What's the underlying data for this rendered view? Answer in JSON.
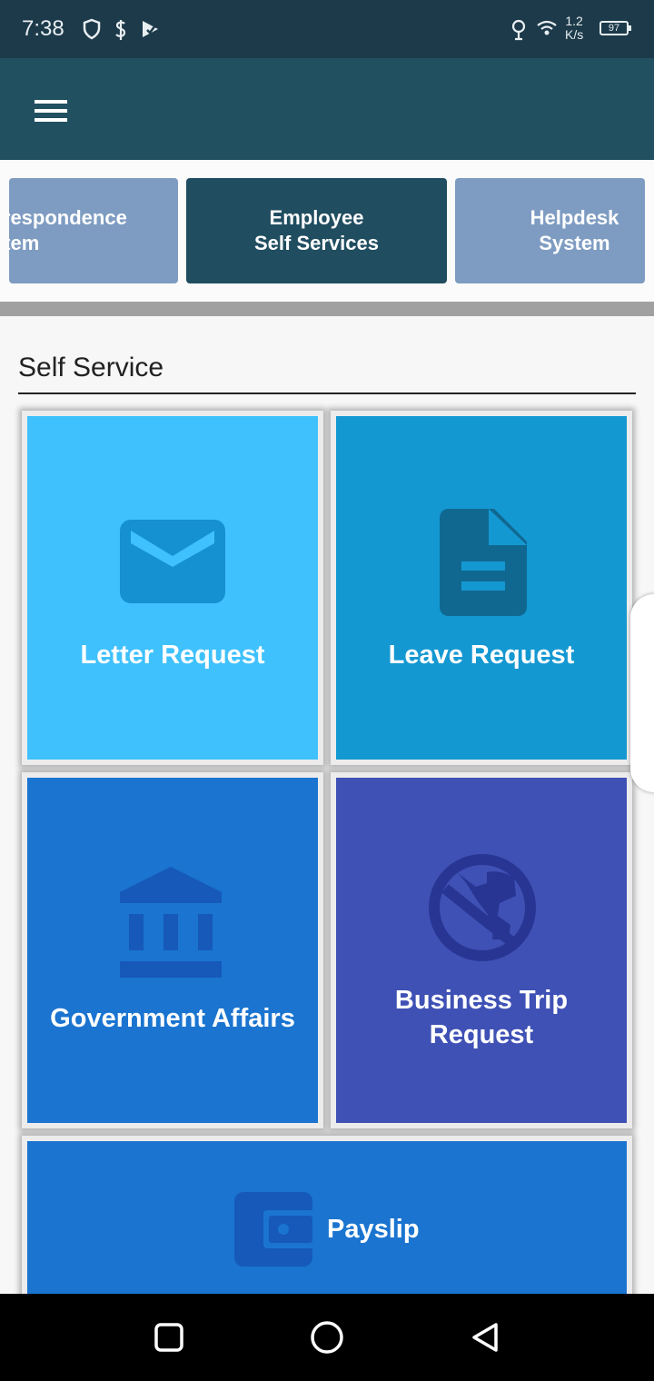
{
  "status_bar": {
    "time": "7:38",
    "net_speed_value": "1.2",
    "net_speed_unit": "K/s",
    "battery": "97",
    "icons": [
      "shield-icon",
      "dollar-icon",
      "play-store-icon",
      "location-icon",
      "wifi-icon"
    ]
  },
  "app_bar": {
    "menu_icon": "hamburger-menu-icon"
  },
  "systems": [
    {
      "label": "Correspondence\nSystem",
      "active": false
    },
    {
      "label": "Employee\nSelf Services",
      "active": true
    },
    {
      "label": "Helpdesk\nSystem",
      "active": false
    }
  ],
  "section": {
    "title": "Self Service"
  },
  "tiles": [
    {
      "label": "Letter Request",
      "icon": "envelope-icon",
      "color": "#3fc1fd"
    },
    {
      "label": "Leave Request",
      "icon": "document-icon",
      "color": "#1498d2"
    },
    {
      "label": "Government Affairs",
      "icon": "bank-icon",
      "color": "#1a74d0"
    },
    {
      "label": "Business Trip\nRequest",
      "icon": "globe-icon",
      "color": "#3f51b5"
    },
    {
      "label": "Payslip",
      "icon": "wallet-icon",
      "color": "#1a74d0"
    }
  ],
  "nav_bar": {
    "buttons": [
      "recent-apps",
      "home",
      "back"
    ]
  }
}
